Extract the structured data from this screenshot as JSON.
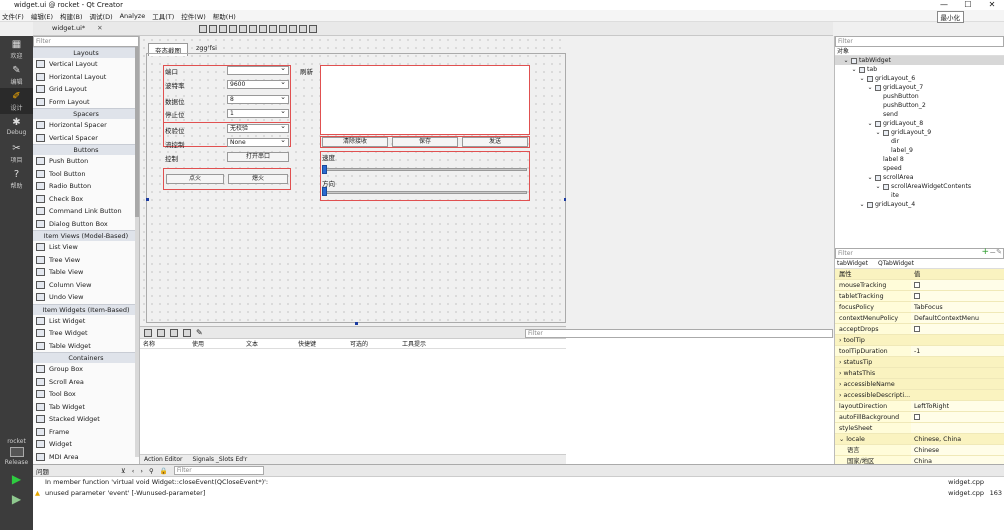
{
  "window": {
    "title": "widget.ui @ rocket - Qt Creator",
    "minimize": "—",
    "maximize": "☐",
    "close": "✕"
  },
  "menu": [
    "文件(F)",
    "编辑(E)",
    "构建(B)",
    "调试(D)",
    "Analyze",
    "工具(T)",
    "控件(W)",
    "帮助(H)"
  ],
  "menu_right": "最小化",
  "file_tab": {
    "name": "widget.ui*",
    "close": "✕"
  },
  "modes": [
    {
      "icon": "▦",
      "label": "欢迎"
    },
    {
      "icon": "✎",
      "label": "编辑"
    },
    {
      "icon": "✐",
      "label": "设计"
    },
    {
      "icon": "✱",
      "label": "Debug"
    },
    {
      "icon": "✂",
      "label": "项目"
    },
    {
      "icon": "?",
      "label": "帮助"
    }
  ],
  "mode_bottom": {
    "project": "rocket",
    "config": "Release",
    "run_icon": "▶",
    "debug_run_icon": "▶"
  },
  "widget_box": {
    "filter": "Filter",
    "groups": [
      {
        "title": "Layouts",
        "items": [
          "Vertical Layout",
          "Horizontal Layout",
          "Grid Layout",
          "Form Layout"
        ]
      },
      {
        "title": "Spacers",
        "items": [
          "Horizontal Spacer",
          "Vertical Spacer"
        ]
      },
      {
        "title": "Buttons",
        "items": [
          "Push Button",
          "Tool Button",
          "Radio Button",
          "Check Box",
          "Command Link Button",
          "Dialog Button Box"
        ]
      },
      {
        "title": "Item Views (Model-Based)",
        "items": [
          "List View",
          "Tree View",
          "Table View",
          "Column View",
          "Undo View"
        ]
      },
      {
        "title": "Item Widgets (Item-Based)",
        "items": [
          "List Widget",
          "Tree Widget",
          "Table Widget"
        ]
      },
      {
        "title": "Containers",
        "items": [
          "Group Box",
          "Scroll Area",
          "Tool Box",
          "Tab Widget",
          "Stacked Widget",
          "Frame",
          "Widget",
          "MDI Area"
        ]
      }
    ]
  },
  "form": {
    "tabs": [
      "夯态截图",
      "zgg'fsi"
    ],
    "labels": {
      "port": "端口",
      "baud": "波特率",
      "databits": "数据位",
      "stopbits": "停止位",
      "parity": "校验位",
      "flow": "流控制",
      "control": "控制"
    },
    "values": {
      "baud": "9600",
      "databits": "8",
      "stopbits": "1",
      "parity": "无校验",
      "flow": "None"
    },
    "buttons": {
      "open": "打开串口",
      "refresh": "刷新",
      "ignite": "点火",
      "extinguish": "熄火",
      "clear": "清除接收",
      "save": "保存",
      "send": "发送"
    },
    "speed_label": "速度",
    "direction_label": "方向"
  },
  "action_editor": {
    "columns": [
      "名称",
      "使用",
      "文本",
      "快捷键",
      "可选的",
      "工具提示"
    ],
    "filter": "Filter",
    "tabs": [
      "Action Editor",
      "Signals _Slots Ed'r"
    ]
  },
  "objects": {
    "filter": "Filter",
    "header": "对象",
    "rows": [
      {
        "name": "tabWidget",
        "depth": 0,
        "sel": true,
        "arrow": "⌄"
      },
      {
        "name": "tab",
        "depth": 1,
        "arrow": "⌄"
      },
      {
        "name": "gridLayout_6",
        "depth": 2,
        "arrow": "⌄"
      },
      {
        "name": "gridLayout_7",
        "depth": 3,
        "arrow": "⌄"
      },
      {
        "name": "pushButton",
        "depth": 4,
        "arrow": ""
      },
      {
        "name": "pushButton_2",
        "depth": 4,
        "arrow": ""
      },
      {
        "name": "send",
        "depth": 4,
        "arrow": ""
      },
      {
        "name": "gridLayout_8",
        "depth": 3,
        "arrow": "⌄"
      },
      {
        "name": "gridLayout_9",
        "depth": 4,
        "arrow": "⌄"
      },
      {
        "name": "dir",
        "depth": 5,
        "arrow": ""
      },
      {
        "name": "label_9",
        "depth": 5,
        "arrow": ""
      },
      {
        "name": "label 8",
        "depth": 4,
        "arrow": ""
      },
      {
        "name": "speed",
        "depth": 4,
        "arrow": ""
      },
      {
        "name": "scrollArea",
        "depth": 3,
        "arrow": "⌄"
      },
      {
        "name": "scrollAreaWidgetContents",
        "depth": 4,
        "arrow": "⌄"
      },
      {
        "name": "ite",
        "depth": 5,
        "arrow": ""
      },
      {
        "name": "gridLayout_4",
        "depth": 2,
        "arrow": "⌄"
      }
    ]
  },
  "properties": {
    "filter": "Filter",
    "class_row": {
      "object": "tabWidget",
      "class": "QTabWidget"
    },
    "header": {
      "prop": "属性",
      "value": "值"
    },
    "rows": [
      {
        "k": "mouseTracking",
        "v": "",
        "chk": true
      },
      {
        "k": "tabletTracking",
        "v": "",
        "chk": true
      },
      {
        "k": "focusPolicy",
        "v": "TabFocus"
      },
      {
        "k": "contextMenuPolicy",
        "v": "DefaultContextMenu"
      },
      {
        "k": "acceptDrops",
        "v": "",
        "chk": true
      },
      {
        "k": "toolTip",
        "v": "",
        "exp": true
      },
      {
        "k": "toolTipDuration",
        "v": "-1"
      },
      {
        "k": "statusTip",
        "v": "",
        "exp": true
      },
      {
        "k": "whatsThis",
        "v": "",
        "exp": true
      },
      {
        "k": "accessibleName",
        "v": "",
        "exp": true
      },
      {
        "k": "accessibleDescripti...",
        "v": "",
        "exp": true
      },
      {
        "k": "layoutDirection",
        "v": "LeftToRight"
      },
      {
        "k": "autoFillBackground",
        "v": "",
        "chk": true
      },
      {
        "k": "styleSheet",
        "v": ""
      },
      {
        "k": "locale",
        "v": "Chinese, China",
        "exp": true,
        "open": true
      },
      {
        "k": "语言",
        "v": "Chinese",
        "indent": true
      },
      {
        "k": "国家/地区",
        "v": "China",
        "indent": true
      }
    ]
  },
  "issues": {
    "title": "问题",
    "filter": "Filter",
    "rows": [
      {
        "text": "In member function 'virtual void Widget::closeEvent(QCloseEvent*)':",
        "file": "widget.cpp",
        "warn": false
      },
      {
        "text": "unused parameter 'event' [-Wunused-parameter]",
        "file": "widget.cpp",
        "line": "163",
        "warn": true
      }
    ]
  }
}
